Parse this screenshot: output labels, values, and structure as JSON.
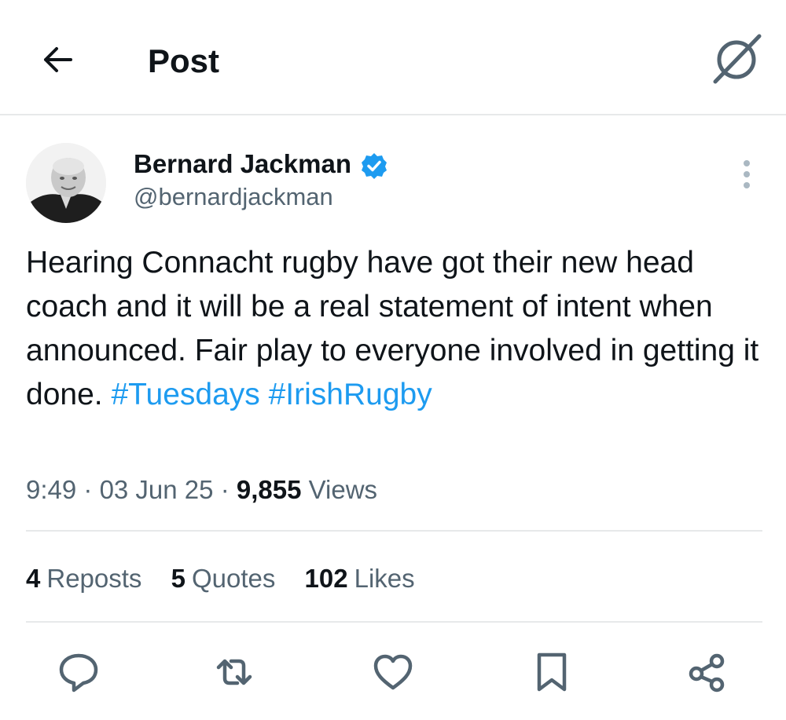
{
  "header": {
    "title": "Post",
    "back_icon": "arrow-left-icon",
    "grok_icon": "grok-icon"
  },
  "author": {
    "display_name": "Bernard Jackman",
    "handle": "@bernardjackman",
    "verified": true,
    "verified_color": "#1d9bf0"
  },
  "post": {
    "text": "Hearing Connacht rugby have got their new head coach and it will be a real statement of intent when announced. Fair play to everyone involved in getting it done. ",
    "hashtags": [
      "#Tuesdays",
      "#IrishRugby"
    ],
    "hashtag_color": "#1d9bf0"
  },
  "meta": {
    "time": "9:49",
    "sep1": " · ",
    "date": "03 Jun 25",
    "sep2": " · ",
    "views_count": "9,855",
    "views_label": "Views"
  },
  "stats": {
    "reposts_count": "4",
    "reposts_label": "Reposts",
    "quotes_count": "5",
    "quotes_label": "Quotes",
    "likes_count": "102",
    "likes_label": "Likes"
  },
  "actions": {
    "reply_icon": "reply-icon",
    "repost_icon": "repost-icon",
    "like_icon": "heart-icon",
    "bookmark_icon": "bookmark-icon",
    "share_icon": "share-icon"
  },
  "colors": {
    "text_primary": "#0f1419",
    "text_secondary": "#536471",
    "divider": "#e7e9ea"
  }
}
